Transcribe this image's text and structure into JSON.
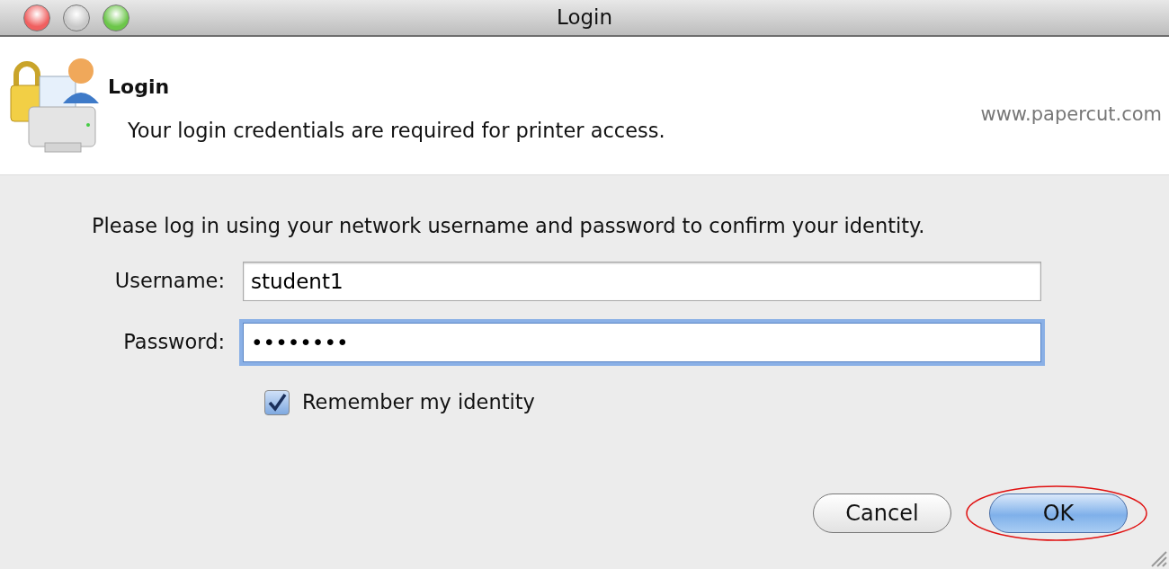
{
  "window": {
    "title": "Login"
  },
  "header": {
    "title": "Login",
    "subtitle": "Your login credentials are required for printer access.",
    "url": "www.papercut.com"
  },
  "instruction": "Please log in using your network username and password to confirm your identity.",
  "fields": [
    {
      "label": "Username:",
      "value": "student1",
      "focused": false
    },
    {
      "label": "Password:",
      "value": "••••••••",
      "focused": true
    }
  ],
  "remember": {
    "label": "Remember my identity",
    "checked": true
  },
  "buttons": [
    {
      "label": "Cancel",
      "kind": "default",
      "circled": false
    },
    {
      "label": "OK",
      "kind": "primary",
      "circled": true
    }
  ]
}
